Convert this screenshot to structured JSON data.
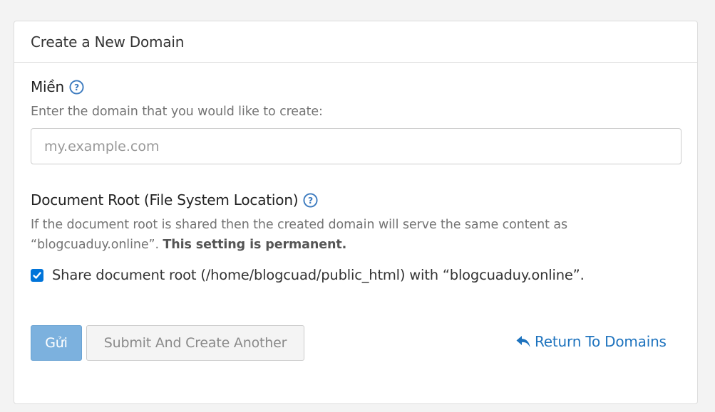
{
  "panel": {
    "title": "Create a New Domain"
  },
  "domain_field": {
    "label": "Miền",
    "help_icon": "question-circle-icon",
    "description": "Enter the domain that you would like to create:",
    "value": "",
    "placeholder": "my.example.com"
  },
  "docroot_field": {
    "label": "Document Root (File System Location)",
    "help_icon": "question-circle-icon",
    "description_line1": "If the document root is shared then the created domain will serve the same content as",
    "description_line2": "“blogcuaduy.online”.",
    "description_bold": "This setting is permanent.",
    "share_checked": true,
    "share_label": "Share document root (/home/blogcuad/public_html) with “blogcuaduy.online”."
  },
  "actions": {
    "submit_label": "Gửi",
    "submit_another_label": "Submit And Create Another",
    "return_label": "Return To Domains",
    "return_icon": "reply-arrow-icon"
  },
  "colors": {
    "accent": "#1e73be",
    "checkbox": "#0074d9",
    "primary_button": "#7cb1de",
    "help_icon": "#3d7bbf"
  }
}
